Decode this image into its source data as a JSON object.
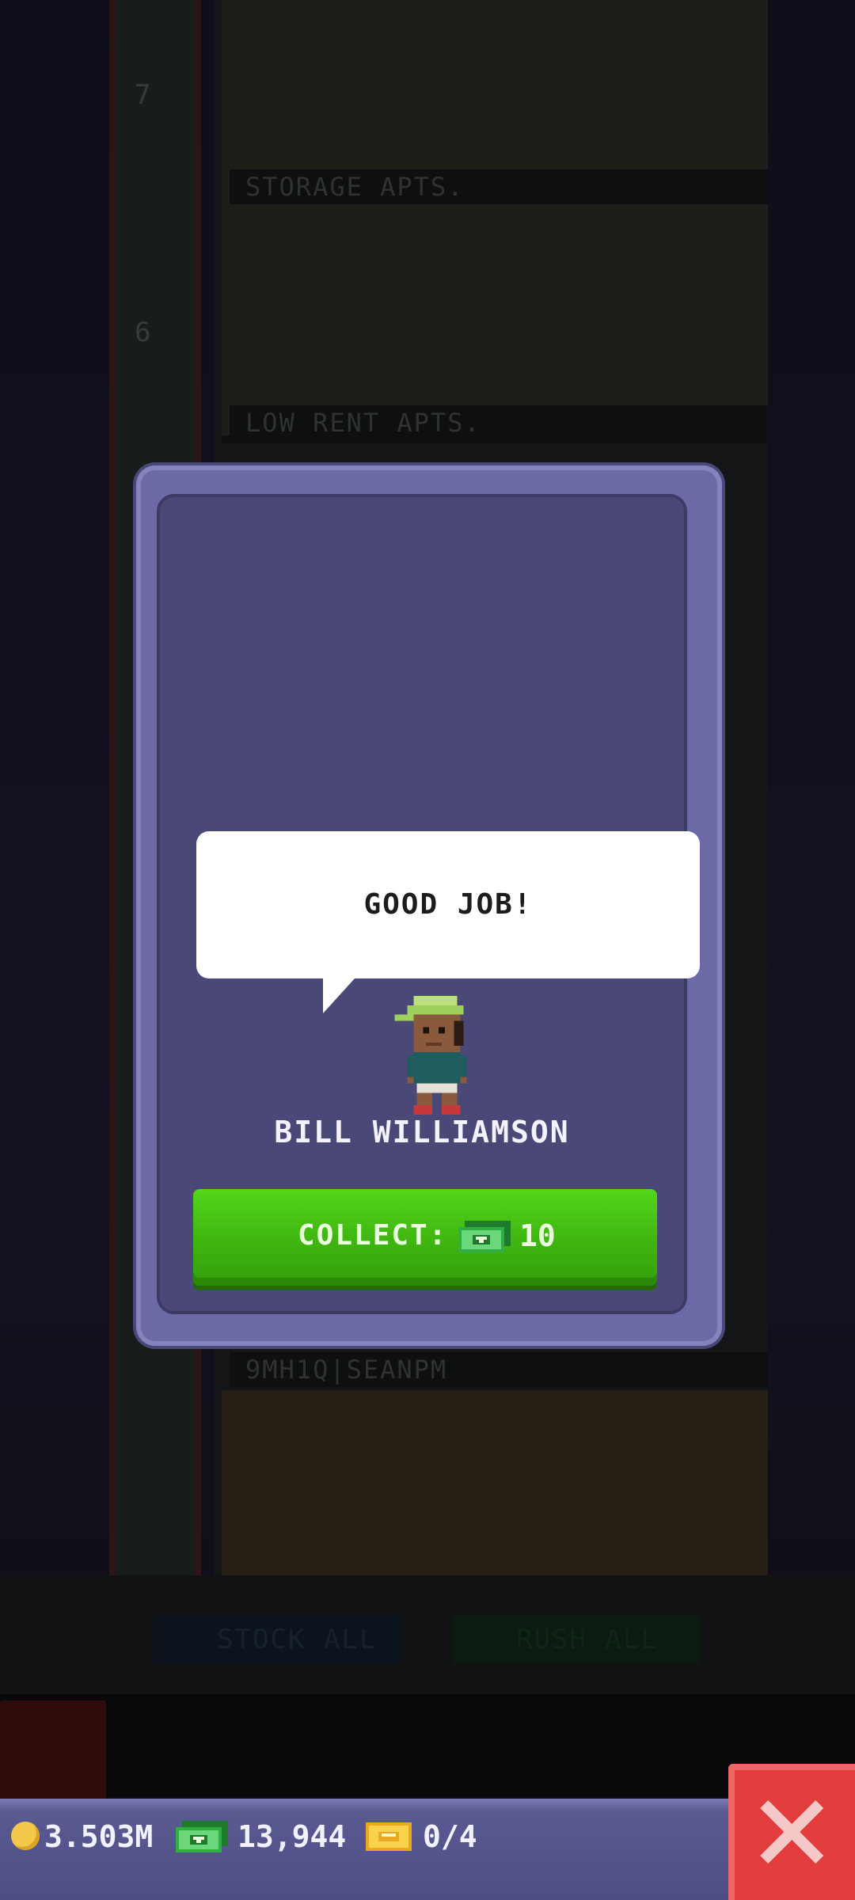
{
  "background": {
    "floors": [
      {
        "label": "STORAGE APTS."
      },
      {
        "label": "LOW RENT APTS."
      },
      {
        "label": "9MH1Q|SEANPM"
      }
    ],
    "elevator_floor_numbers": [
      "7",
      "6"
    ],
    "buttons": {
      "stock_all": "STOCK ALL",
      "rush_all": "RUSH ALL"
    }
  },
  "modal": {
    "speech": "GOOD JOB!",
    "npc_name": "BILL WILLIAMSON",
    "collect_label": "COLLECT:",
    "collect_amount": "10",
    "collect_currency_icon": "tower-bux-icon"
  },
  "hud": {
    "coins": "3.503M",
    "bux": "13,944",
    "tickets": "0/4",
    "icons": [
      "coin-icon",
      "tower-bux-icon",
      "golden-ticket-icon"
    ],
    "close_icon": "close-icon"
  },
  "colors": {
    "modal_bg": "#4a4876",
    "collect_green": "#3fb510",
    "close_red": "#e23c3c"
  }
}
